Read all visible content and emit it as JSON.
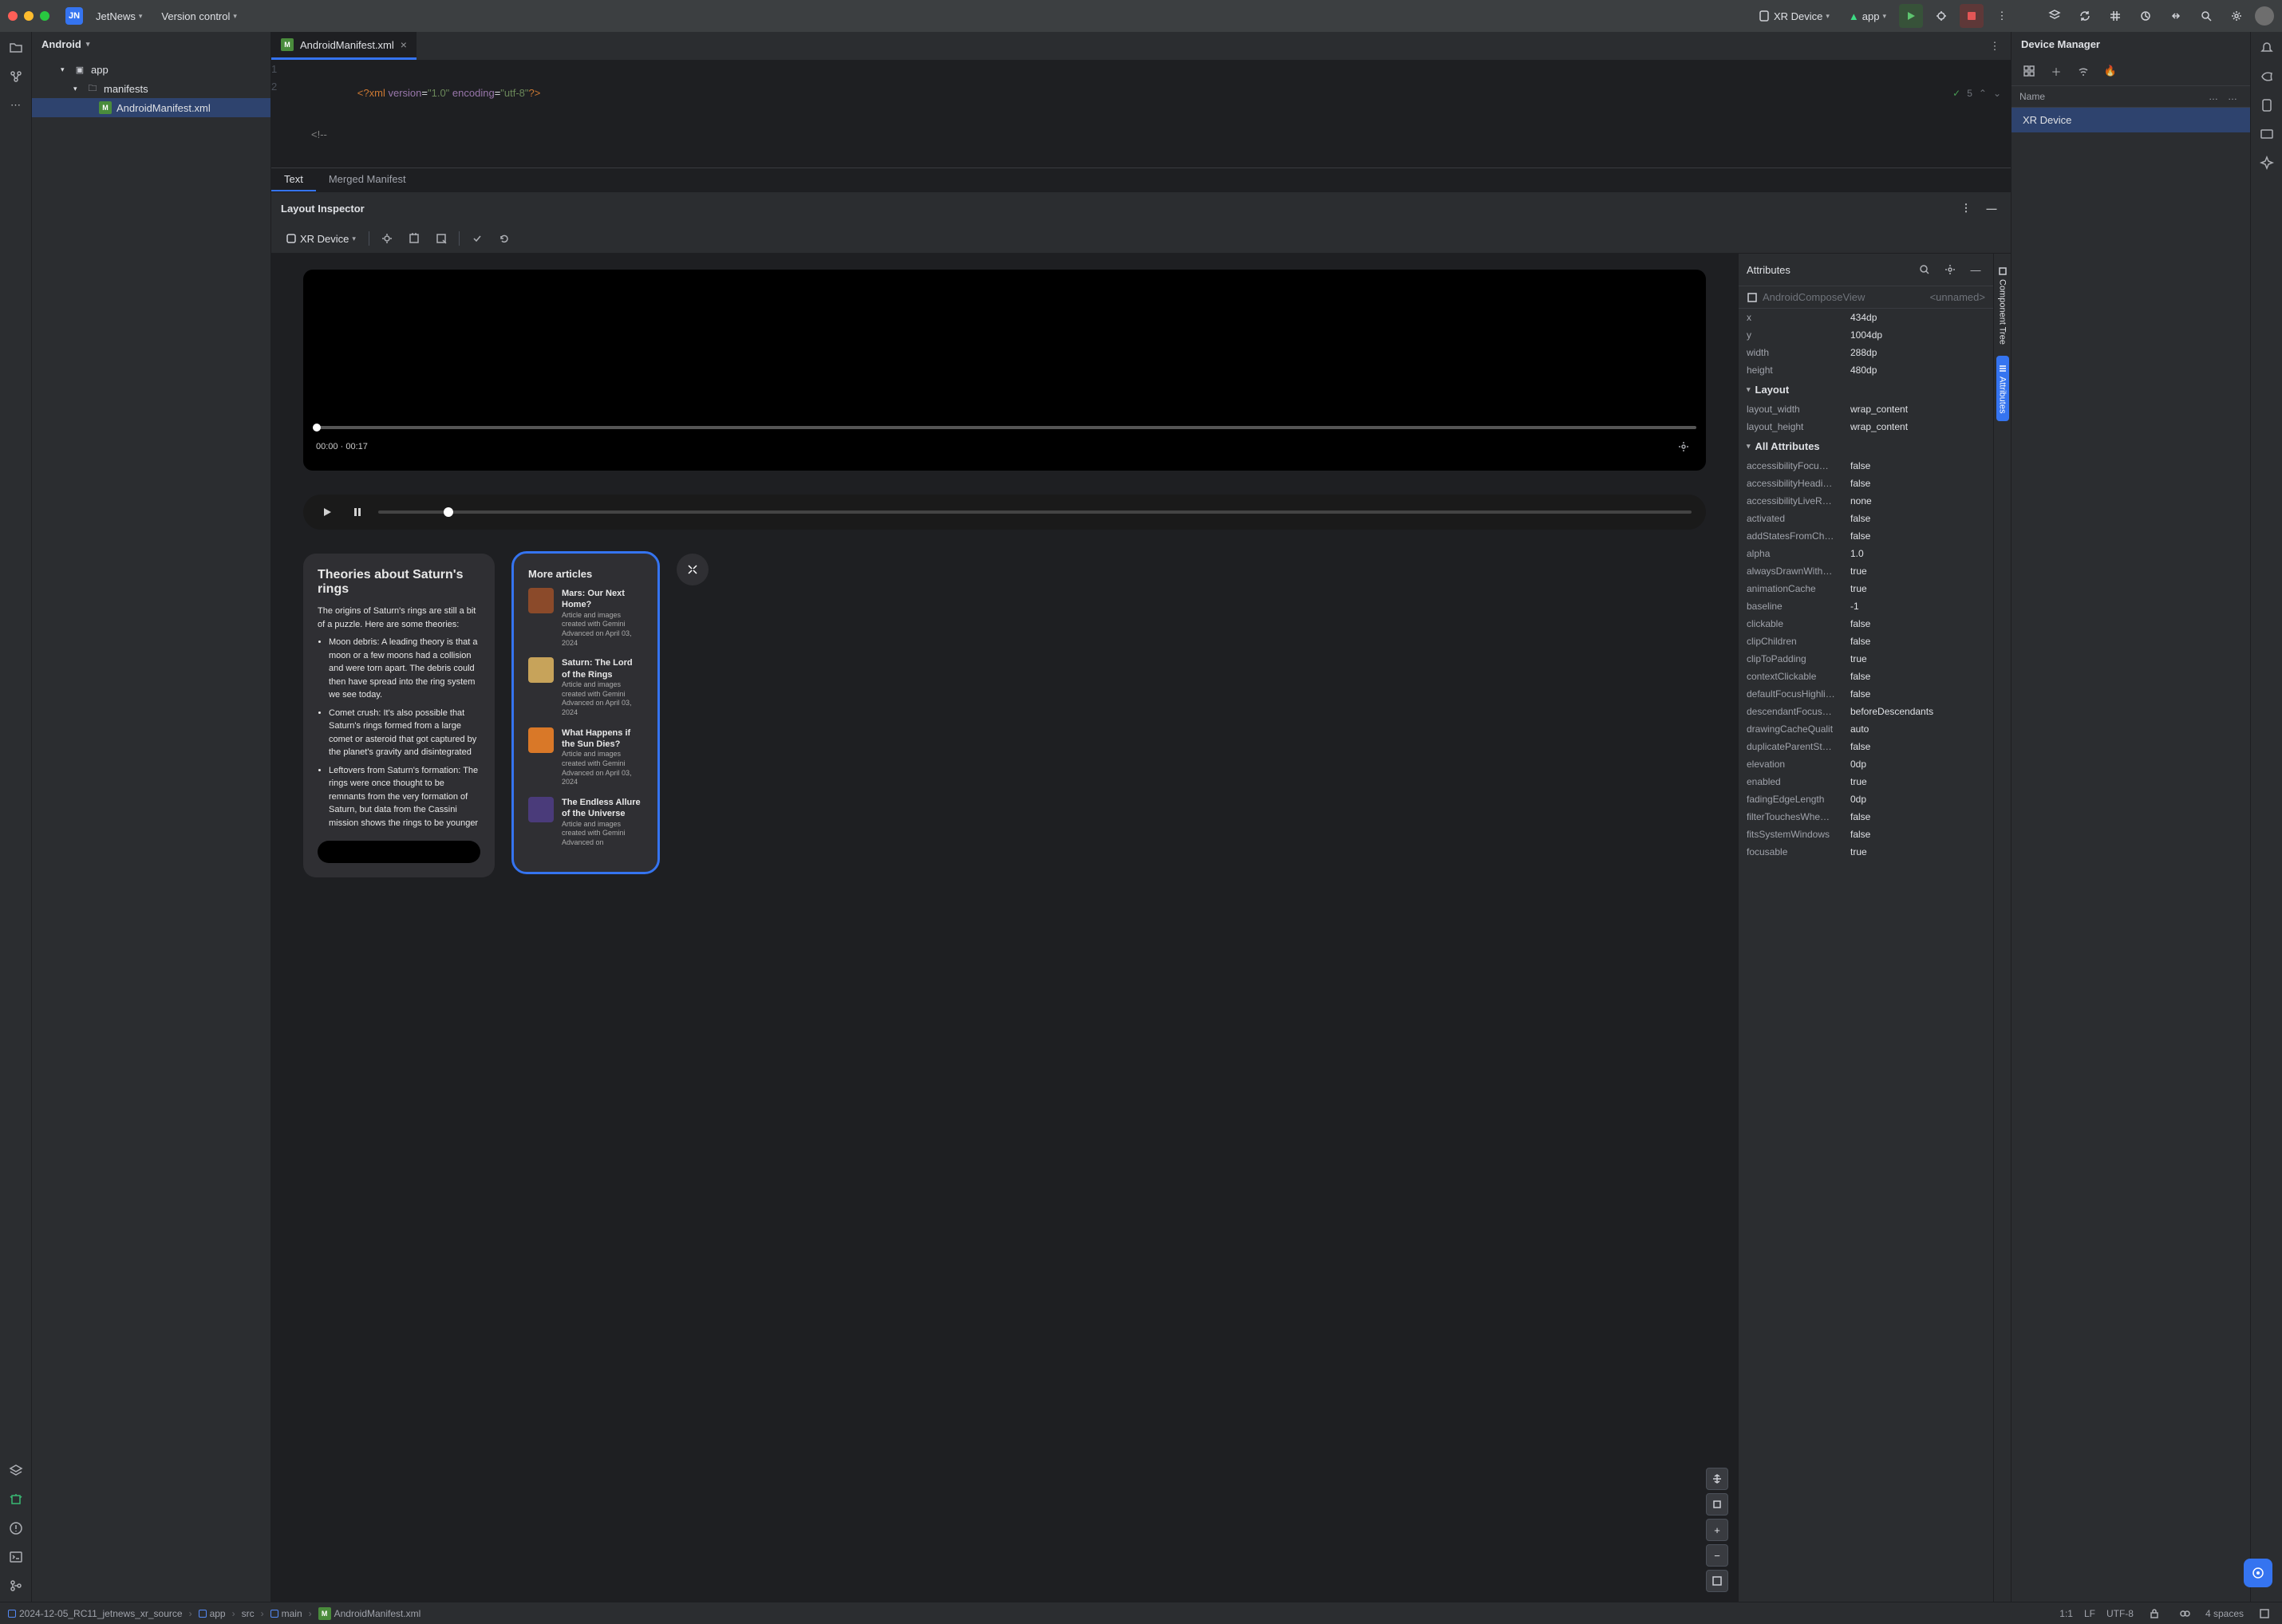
{
  "titlebar": {
    "project_badge": "JN",
    "project_name": "JetNews",
    "vcs_label": "Version control",
    "device_label": "XR Device",
    "run_config": "app"
  },
  "project_pane": {
    "view_mode": "Android",
    "tree": {
      "app": "app",
      "manifests": "manifests",
      "manifest_file": "AndroidManifest.xml"
    }
  },
  "editor": {
    "tab_file": "AndroidManifest.xml",
    "line1_num": "1",
    "line2_num": "2",
    "code_line1_pre": "<?",
    "code_line1_tag": "xml ",
    "code_line1_attr1": "version",
    "code_line1_eq": "=",
    "code_line1_val1": "\"1.0\"",
    "code_line1_attr2": " encoding",
    "code_line1_val2": "\"utf-8\"",
    "code_line1_post": "?>",
    "code_line2": "<!--",
    "problems_count": "5",
    "subtab_text": "Text",
    "subtab_merged": "Merged Manifest"
  },
  "layout_inspector": {
    "title": "Layout Inspector",
    "device": "XR Device"
  },
  "preview": {
    "video_time_cur": "00:00",
    "video_time_dur": "00:17",
    "theories": {
      "title": "Theories about Saturn's rings",
      "intro": "The origins of Saturn's rings are still a bit of a puzzle. Here are some theories:",
      "b1": "Moon debris: A leading theory is that a moon or a few moons had a collision and were torn apart. The debris could then have spread into the ring system we see today.",
      "b2": "Comet crush: It's also possible that Saturn's rings formed from a large comet or asteroid that got captured by the planet's gravity and disintegrated",
      "b3": "Leftovers from Saturn's formation: The rings were once thought to be remnants from the very formation of Saturn, but data from the Cassini mission shows the rings to be younger"
    },
    "more_articles": {
      "title": "More articles",
      "items": [
        {
          "title": "Mars: Our Next Home?",
          "meta": "Article and images created with Gemini Advanced on April 03, 2024"
        },
        {
          "title": "Saturn: The Lord of the Rings",
          "meta": "Article and images created with Gemini Advanced on April 03, 2024"
        },
        {
          "title": "What Happens if the Sun Dies?",
          "meta": "Article and images created with Gemini Advanced on April 03, 2024"
        },
        {
          "title": "The Endless Allure of the Universe",
          "meta": "Article and images created with Gemini Advanced on"
        }
      ]
    }
  },
  "attributes": {
    "header": "Attributes",
    "component": "AndroidComposeView",
    "component_id": "<unnamed>",
    "section_layout": "Layout",
    "section_all": "All Attributes",
    "basic": [
      {
        "k": "x",
        "v": "434dp"
      },
      {
        "k": "y",
        "v": "1004dp"
      },
      {
        "k": "width",
        "v": "288dp"
      },
      {
        "k": "height",
        "v": "480dp"
      }
    ],
    "layout": [
      {
        "k": "layout_width",
        "v": "wrap_content"
      },
      {
        "k": "layout_height",
        "v": "wrap_content"
      }
    ],
    "all": [
      {
        "k": "accessibilityFocu…",
        "v": "false"
      },
      {
        "k": "accessibilityHeadi…",
        "v": "false"
      },
      {
        "k": "accessibilityLiveR…",
        "v": "none"
      },
      {
        "k": "activated",
        "v": "false"
      },
      {
        "k": "addStatesFromCh…",
        "v": "false"
      },
      {
        "k": "alpha",
        "v": "1.0"
      },
      {
        "k": "alwaysDrawnWith…",
        "v": "true"
      },
      {
        "k": "animationCache",
        "v": "true"
      },
      {
        "k": "baseline",
        "v": "-1"
      },
      {
        "k": "clickable",
        "v": "false"
      },
      {
        "k": "clipChildren",
        "v": "false"
      },
      {
        "k": "clipToPadding",
        "v": "true"
      },
      {
        "k": "contextClickable",
        "v": "false"
      },
      {
        "k": "defaultFocusHighli…",
        "v": "false"
      },
      {
        "k": "descendantFocus…",
        "v": "beforeDescendants"
      },
      {
        "k": "drawingCacheQualit",
        "v": "auto"
      },
      {
        "k": "duplicateParentSt…",
        "v": "false"
      },
      {
        "k": "elevation",
        "v": "0dp"
      },
      {
        "k": "enabled",
        "v": "true"
      },
      {
        "k": "fadingEdgeLength",
        "v": "0dp"
      },
      {
        "k": "filterTouchesWhe…",
        "v": "false"
      },
      {
        "k": "fitsSystemWindows",
        "v": "false"
      },
      {
        "k": "focusable",
        "v": "true"
      }
    ]
  },
  "side_rail": {
    "tab1": "Component Tree",
    "tab2": "Attributes"
  },
  "device_manager": {
    "title": "Device Manager",
    "col_name": "Name",
    "col2": "…",
    "col3": "…",
    "row1": "XR Device"
  },
  "statusbar": {
    "crumb1": "2024-12-05_RC11_jetnews_xr_source",
    "crumb2": "app",
    "crumb3": "src",
    "crumb4": "main",
    "crumb5": "AndroidManifest.xml",
    "pos": "1:1",
    "line_sep": "LF",
    "encoding": "UTF-8",
    "indent": "4 spaces"
  }
}
